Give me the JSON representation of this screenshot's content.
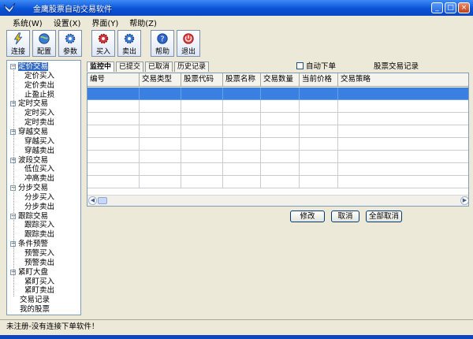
{
  "window": {
    "title": "金鹰股票自动交易软件"
  },
  "menu": [
    "系统(W)",
    "设置(X)",
    "界面(Y)",
    "帮助(Z)"
  ],
  "toolbar": {
    "connect": "连接",
    "config": "配置",
    "params": "参数",
    "buy": "买入",
    "sell": "卖出",
    "help": "帮助",
    "exit": "退出"
  },
  "tree": [
    {
      "label": "定价交易",
      "level": 0,
      "selected": true
    },
    {
      "label": "定价买入",
      "level": 1
    },
    {
      "label": "定价卖出",
      "level": 1
    },
    {
      "label": "止盈止损",
      "level": 1
    },
    {
      "label": "定时交易",
      "level": 0
    },
    {
      "label": "定时买入",
      "level": 1
    },
    {
      "label": "定时卖出",
      "level": 1
    },
    {
      "label": "穿越交易",
      "level": 0
    },
    {
      "label": "穿越买入",
      "level": 1
    },
    {
      "label": "穿越卖出",
      "level": 1
    },
    {
      "label": "波段交易",
      "level": 0
    },
    {
      "label": "低位买入",
      "level": 1
    },
    {
      "label": "冲高卖出",
      "level": 1
    },
    {
      "label": "分步交易",
      "level": 0
    },
    {
      "label": "分步买入",
      "level": 1
    },
    {
      "label": "分步卖出",
      "level": 1
    },
    {
      "label": "跟踪交易",
      "level": 0
    },
    {
      "label": "跟踪买入",
      "level": 1
    },
    {
      "label": "跟踪卖出",
      "level": 1
    },
    {
      "label": "条件预警",
      "level": 0
    },
    {
      "label": "预警买入",
      "level": 1
    },
    {
      "label": "预警卖出",
      "level": 1
    },
    {
      "label": "紧盯大盘",
      "level": 0
    },
    {
      "label": "紧盯买入",
      "level": 1
    },
    {
      "label": "紧盯卖出",
      "level": 1
    },
    {
      "label": "交易记录",
      "level": 0,
      "leaf": true
    },
    {
      "label": "我的股票",
      "level": 0,
      "leaf": true
    }
  ],
  "tabs": [
    "监控中",
    "已提交",
    "已取消",
    "历史记录"
  ],
  "auto_order_label": "自动下单",
  "records_label": "股票交易记录",
  "grid": {
    "columns": [
      "编号",
      "交易类型",
      "股票代码",
      "股票名称",
      "交易数量",
      "当前价格",
      "交易策略"
    ]
  },
  "buttons": {
    "modify": "修改",
    "cancel": "取消",
    "cancel_all": "全部取消"
  },
  "status": "未注册-没有连接下单软件！"
}
